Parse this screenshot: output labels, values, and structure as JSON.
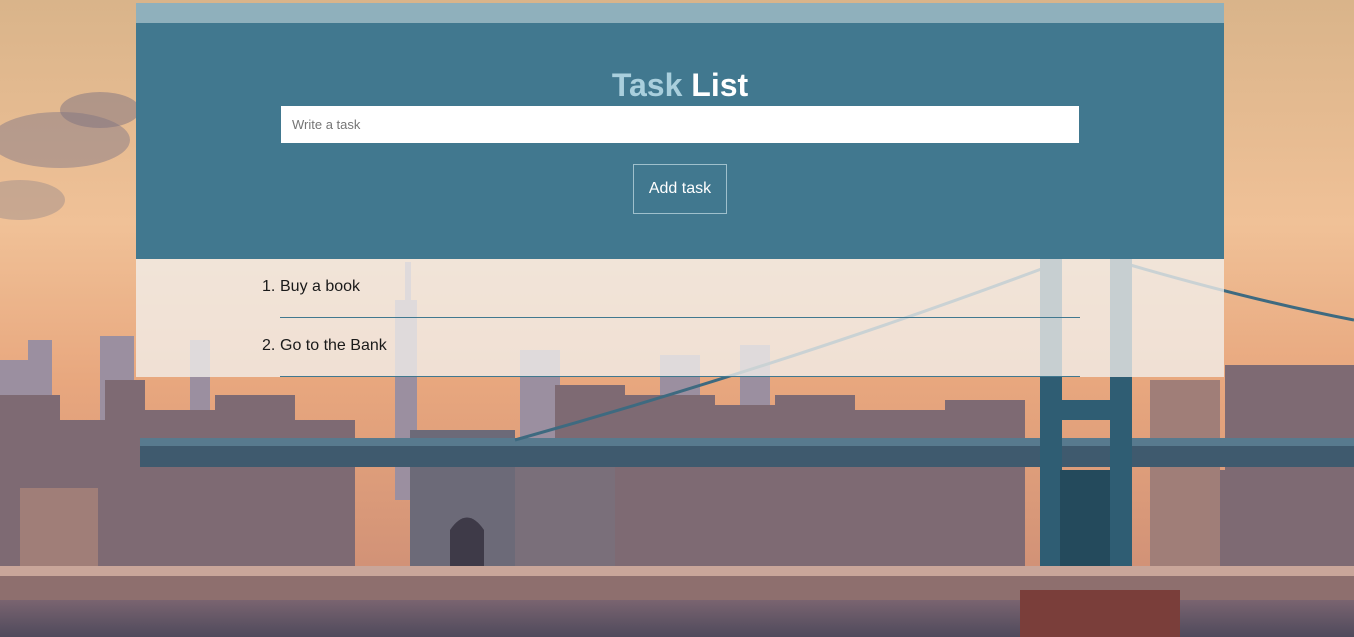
{
  "app": {
    "title_part1": "Task",
    "title_part2": "List"
  },
  "form": {
    "task_input_value": "",
    "task_input_placeholder": "Write a task",
    "add_button_label": "Add task"
  },
  "tasks": [
    {
      "number": "1.",
      "text": "Buy a book"
    },
    {
      "number": "2.",
      "text": "Go to the Bank"
    }
  ],
  "colors": {
    "header_bg": "#41788f",
    "top_strip": "#8fb0bc",
    "title_accent": "#a9cfdd",
    "list_divider": "#41788f"
  }
}
